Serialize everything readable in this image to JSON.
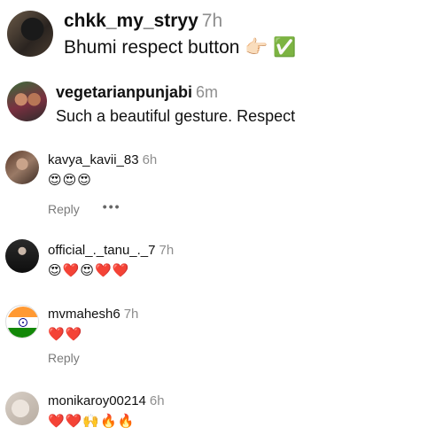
{
  "comments": [
    {
      "username": "chkk_my_stryy",
      "time": "7h",
      "text": "Bhumi respect button 👉🏻 ✅"
    },
    {
      "username": "vegetarianpunjabi",
      "time": "6m",
      "text": "Such a beautiful gesture. Respect"
    },
    {
      "username": "kavya_kavii_83",
      "time": "6h",
      "emojis": "😍😍😍",
      "reply_label": "Reply",
      "more_label": "•••"
    },
    {
      "username": "official_._tanu_._7",
      "time": "7h",
      "emojis": "😍❤️😍❤️❤️"
    },
    {
      "username": "mvmahesh6",
      "time": "7h",
      "emojis": "❤️❤️",
      "reply_label": "Reply"
    },
    {
      "username": "monikaroy00214",
      "time": "6h",
      "emojis": "❤️❤️🙌🔥🔥"
    }
  ],
  "icons": {
    "more": "more-options-icon",
    "flag": "indian-flag-avatar"
  },
  "colors": {
    "username": "#111111",
    "timestamp": "#8e8e8e",
    "reply": "#7a7a7a",
    "flag_saffron": "#ff9933",
    "flag_green": "#138808",
    "flag_chakra": "#000080"
  }
}
